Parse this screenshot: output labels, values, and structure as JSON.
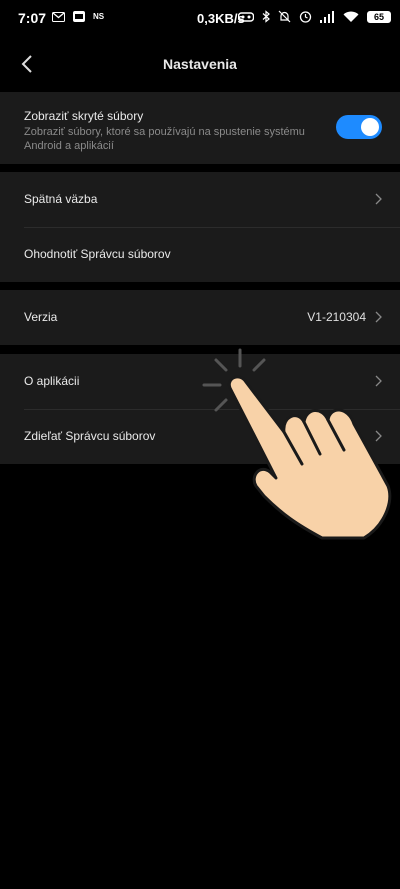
{
  "status_bar": {
    "time": "7:07",
    "ns_label": "NS",
    "speed": "0,3KB/s",
    "battery": "65"
  },
  "header": {
    "title": "Nastavenia"
  },
  "settings": {
    "hidden_files": {
      "title": "Zobraziť skryté súbory",
      "subtitle": "Zobraziť súbory, ktoré sa používajú na spustenie systému Android a aplikácií",
      "enabled": true
    },
    "feedback": "Spätná väzba",
    "rate": "Ohodnotiť Správcu súborov",
    "version_label": "Verzia",
    "version_value": "V1-210304",
    "about": "O aplikácii",
    "share": "Zdieľať Správcu súborov"
  },
  "colors": {
    "accent": "#1e8bff",
    "card": "#1b1b1b",
    "background": "#000000"
  }
}
